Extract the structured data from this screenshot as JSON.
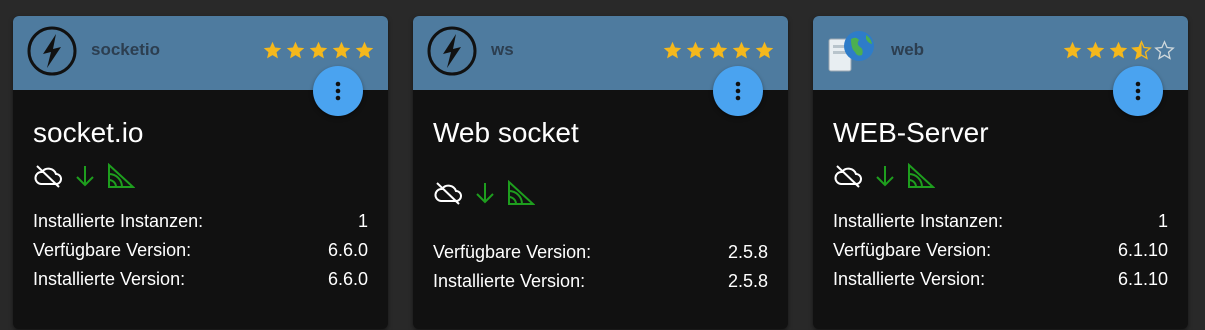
{
  "colors": {
    "background": "#292929",
    "card": "#111111",
    "header": "#4e7b9f",
    "menu_button": "#4aa3f0",
    "star": "#f5b81c",
    "status_green": "#1e9e1e"
  },
  "cards": [
    {
      "adapter": "socketio",
      "logo": "socketio-logo-icon",
      "rating": 5,
      "title": "socket.io",
      "rows": [
        {
          "label": "Installierte Instanzen:",
          "value": "1"
        },
        {
          "label": "Verfügbare Version:",
          "value": "6.6.0"
        },
        {
          "label": "Installierte Version:",
          "value": "6.6.0"
        }
      ]
    },
    {
      "adapter": "ws",
      "logo": "socketio-logo-icon",
      "rating": 5,
      "title": "Web socket",
      "rows": [
        {
          "label": "Verfügbare Version:",
          "value": "2.5.8"
        },
        {
          "label": "Installierte Version:",
          "value": "2.5.8"
        }
      ]
    },
    {
      "adapter": "web",
      "logo": "web-server-globe-icon",
      "rating": 3.5,
      "title": "WEB-Server",
      "rows": [
        {
          "label": "Installierte Instanzen:",
          "value": "1"
        },
        {
          "label": "Verfügbare Version:",
          "value": "6.1.10"
        },
        {
          "label": "Installierte Version:",
          "value": "6.1.10"
        }
      ]
    }
  ]
}
